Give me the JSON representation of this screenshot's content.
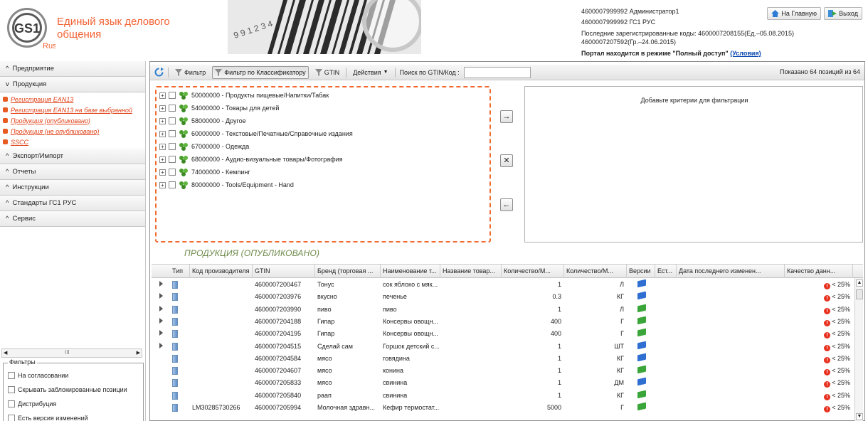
{
  "header": {
    "logo_text": "GS1",
    "logo_sub": "Russia",
    "tagline": "Единый язык делового общения",
    "user_line": "4600007999992 Администратор1",
    "company_line": "4600007999992 ГС1 РУС",
    "last_codes": "Последние зарегистрированные коды: 4600007208155(Ед.–05.08.2015) 4600007207592(Гр.–24.06.2015)",
    "portal_mode": "Портал находится в режиме \"Полный доступ\"",
    "portal_mode_link": "(Условия)",
    "home_btn": "На Главную",
    "exit_btn": "Выход",
    "banner_digits": "9 9 1 2 3 4"
  },
  "sidebar": {
    "sections": [
      {
        "label": "Предприятие",
        "expanded": false
      },
      {
        "label": "Продукция",
        "expanded": true
      },
      {
        "label": "Экспорт/Импорт",
        "expanded": false
      },
      {
        "label": "Отчеты",
        "expanded": false
      },
      {
        "label": "Инструкции",
        "expanded": false
      },
      {
        "label": "Стандарты ГС1 РУС",
        "expanded": false
      },
      {
        "label": "Сервис",
        "expanded": false
      }
    ],
    "product_items": [
      "Регистрация EAN13",
      "Регистрация EAN13 на базе выбранной",
      "Продукция (опубликовано)",
      "Продукция (не опубликовано)",
      "SSCC"
    ],
    "scroll_marker": "III",
    "filters_legend": "Фильтры",
    "filters": [
      "На согласовании",
      "Скрывать заблокированные позиции",
      "Дистрибуция",
      "Есть версия изменений"
    ]
  },
  "toolbar": {
    "filter": "Фильтр",
    "filter_classifier": "Фильтр по Классификатору",
    "gtin": "GTIN",
    "actions": "Действия",
    "search_label": "Поиск по GTIN/Код :",
    "search_value": "",
    "shown": "Показано 64 позиций из 64"
  },
  "tree": [
    "50000000 - Продукты пищевые/Напитки/Табак",
    "54000000 - Товары для детей",
    "58000000 - Другое",
    "60000000 - Текстовые/Печатные/Справочные издания",
    "67000000 - Одежда",
    "68000000 - Аудио-визуальные товары/Фотография",
    "74000000 - Кемпинг",
    "80000000 - Tools/Equipment - Hand"
  ],
  "criteria_text": "Добавьте критерии для фильтрации",
  "grid": {
    "title": "ПРОДУКЦИЯ (ОПУБЛИКОВАНО)",
    "columns": [
      "Тип",
      "Код производителя",
      "GTIN",
      "Бренд (торговая ...",
      "Наименование т...",
      "Название товар...",
      "Количество/М...",
      "Количество/М...",
      "Версии",
      "Ест...",
      "Дата последнего изменен...",
      "Качество данн..."
    ],
    "rows": [
      {
        "exp": true,
        "code": "",
        "gtin": "4600007200467",
        "brand": "Тонус",
        "name": "сок яблоко с мяк...",
        "title": "",
        "qty": "1",
        "unit": "Л",
        "ver": "blue",
        "quality": "< 25%"
      },
      {
        "exp": true,
        "code": "",
        "gtin": "4600007203976",
        "brand": "вкусно",
        "name": "печенье",
        "title": "",
        "qty": "0.3",
        "unit": "КГ",
        "ver": "blue",
        "quality": "< 25%"
      },
      {
        "exp": true,
        "code": "",
        "gtin": "4600007203990",
        "brand": "пиво",
        "name": "пиво",
        "title": "",
        "qty": "1",
        "unit": "Л",
        "ver": "green",
        "quality": "< 25%"
      },
      {
        "exp": true,
        "code": "",
        "gtin": "4600007204188",
        "brand": "Гипар",
        "name": "Консервы овощн...",
        "title": "",
        "qty": "400",
        "unit": "Г",
        "ver": "green",
        "quality": "< 25%"
      },
      {
        "exp": true,
        "code": "",
        "gtin": "4600007204195",
        "brand": "Гипар",
        "name": "Консервы овощн...",
        "title": "",
        "qty": "400",
        "unit": "Г",
        "ver": "green",
        "quality": "< 25%"
      },
      {
        "exp": true,
        "code": "",
        "gtin": "4600007204515",
        "brand": "Сделай сам",
        "name": "Горшок детский с...",
        "title": "",
        "qty": "1",
        "unit": "ШТ",
        "ver": "blue",
        "quality": "< 25%"
      },
      {
        "exp": false,
        "code": "",
        "gtin": "4600007204584",
        "brand": "мясо",
        "name": "говядина",
        "title": "",
        "qty": "1",
        "unit": "КГ",
        "ver": "blue",
        "quality": "< 25%"
      },
      {
        "exp": false,
        "code": "",
        "gtin": "4600007204607",
        "brand": "мясо",
        "name": "конина",
        "title": "",
        "qty": "1",
        "unit": "КГ",
        "ver": "green",
        "quality": "< 25%"
      },
      {
        "exp": false,
        "code": "",
        "gtin": "4600007205833",
        "brand": "мясо",
        "name": "свинина",
        "title": "",
        "qty": "1",
        "unit": "ДМ",
        "ver": "blue",
        "quality": "< 25%"
      },
      {
        "exp": false,
        "code": "",
        "gtin": "4600007205840",
        "brand": "раап",
        "name": "свинина",
        "title": "",
        "qty": "1",
        "unit": "КГ",
        "ver": "green",
        "quality": "< 25%"
      },
      {
        "exp": false,
        "code": "LM30285730266",
        "gtin": "4600007205994",
        "brand": "Молочная здравн...",
        "name": "Кефир термостат...",
        "title": "",
        "qty": "5000",
        "unit": "Г",
        "ver": "green",
        "quality": "< 25%"
      }
    ]
  },
  "colors": {
    "accent_orange": "#f26334",
    "grid_title_green": "#6e8a4a",
    "link_blue": "#0645ad",
    "book_blue": "#2f6fd1",
    "book_green": "#3aa63a",
    "warn_red": "#e7301e"
  }
}
